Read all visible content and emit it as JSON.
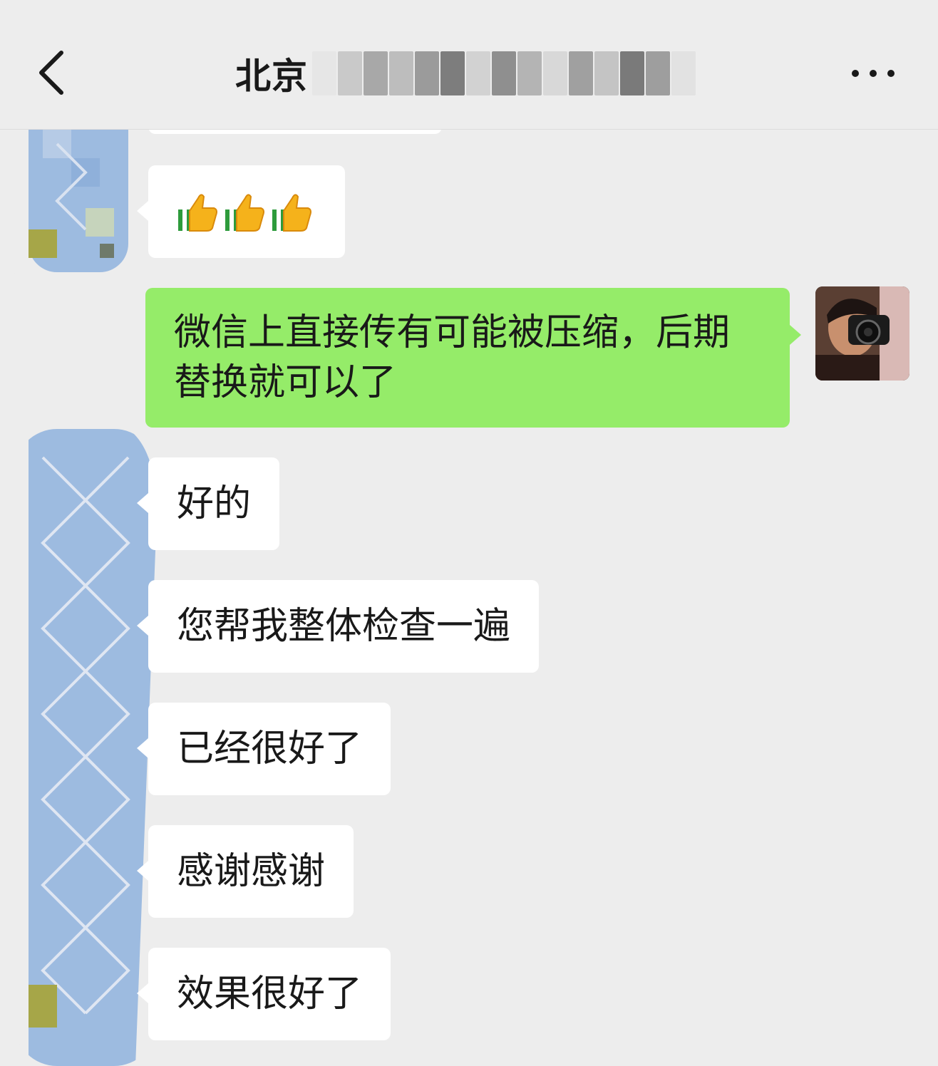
{
  "header": {
    "title_visible": "北京",
    "back_icon": "chevron-left-icon",
    "more_icon": "more-dots-icon"
  },
  "messages": [
    {
      "side": "left",
      "type": "emoji",
      "content": [
        "thumbs-up",
        "thumbs-up",
        "thumbs-up"
      ]
    },
    {
      "side": "right",
      "type": "text",
      "text": "微信上直接传有可能被压缩，后期替换就可以了"
    },
    {
      "side": "left",
      "type": "text",
      "text": "好的"
    },
    {
      "side": "left",
      "type": "text",
      "text": "您帮我整体检查一遍"
    },
    {
      "side": "left",
      "type": "text",
      "text": "已经很好了"
    },
    {
      "side": "left",
      "type": "text",
      "text": "感谢感谢"
    },
    {
      "side": "left",
      "type": "text",
      "text": "效果很好了"
    }
  ],
  "colors": {
    "background": "#ededed",
    "bubble_left": "#ffffff",
    "bubble_right": "#95ec69",
    "text": "#191919"
  }
}
